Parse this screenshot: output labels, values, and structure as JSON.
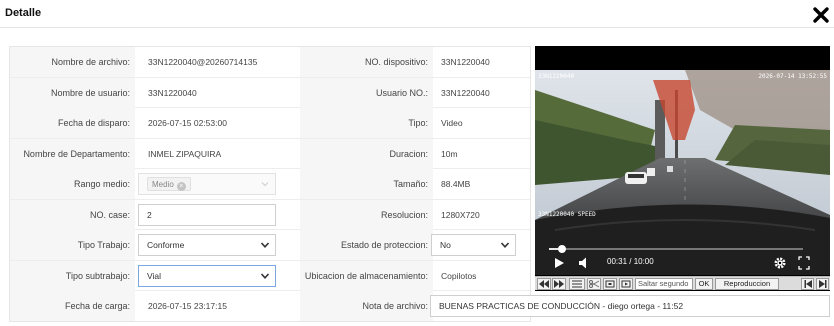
{
  "dialog": {
    "title": "Detalle"
  },
  "fields": {
    "file_name": {
      "label": "Nombre de archivo:",
      "value": "33N1220040@20260714135"
    },
    "device_no": {
      "label": "NO. dispositivo:",
      "value": "33N1220040"
    },
    "user_name": {
      "label": "Nombre de usuario:",
      "value": "33N1220040"
    },
    "user_no": {
      "label": "Usuario NO.:",
      "value": "33N1220040"
    },
    "trigger_date": {
      "label": "Fecha de disparo:",
      "value": "2026-07-15 02:53:00"
    },
    "type": {
      "label": "Tipo:",
      "value": "Video"
    },
    "department": {
      "label": "Nombre de Departamento:",
      "value": "INMEL ZIPAQUIRA"
    },
    "duration": {
      "label": "Duracion:",
      "value": "10m"
    },
    "medium_range": {
      "label": "Rango medio:",
      "tag": "Medio"
    },
    "size": {
      "label": "Tamaño:",
      "value": "88.4MB"
    },
    "case_no": {
      "label": "NO. case:",
      "value": "2"
    },
    "resolution": {
      "label": "Resolucion:",
      "value": "1280X720"
    },
    "work_type": {
      "label": "Tipo Trabajo:",
      "value": "Conforme"
    },
    "protection_state": {
      "label": "Estado de proteccion:",
      "value": "No"
    },
    "work_subtype": {
      "label": "Tipo subtrabajo:",
      "value": "Vial"
    },
    "storage_location": {
      "label": "Ubicacion de almacenamiento:",
      "value": "Copilotos"
    },
    "upload_date": {
      "label": "Fecha de carga:",
      "value": "2026-07-15 23:17:15"
    },
    "file_note": {
      "label": "Nota de archivo:",
      "value": "BUENAS PRACTICAS DE CONDUCCIÓN - diego ortega - 11:52"
    }
  },
  "video": {
    "osd_top_left": "33N1220040",
    "osd_top_right": "2026-07-14 13:52:55",
    "osd_bottom_left": "33N1220040 SPEED",
    "time": "00:31 / 10:00",
    "progress": 0.05,
    "volume": 0.4
  },
  "toolbar": {
    "skip_placeholder": "Saltar segundo",
    "ok_label": "OK",
    "playback_label": "Reproduccion"
  },
  "colors": {
    "focus_border": "#7aa7e0",
    "label_bg": "#f6f6f6"
  }
}
